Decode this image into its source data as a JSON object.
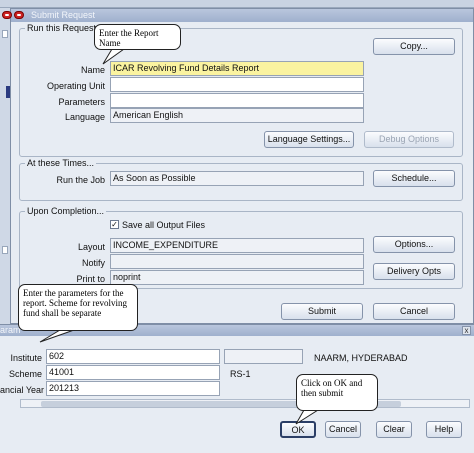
{
  "submit_request": {
    "title": "Submit Request",
    "run_group_label": "Run this Request...",
    "copy_label": "Copy...",
    "name_label": "Name",
    "name_value": "ICAR Revolving Fund Details Report",
    "operating_unit_label": "Operating Unit",
    "operating_unit_value": "",
    "parameters_label": "Parameters",
    "parameters_value": "",
    "language_label": "Language",
    "language_value": "American English",
    "language_settings_label": "Language Settings...",
    "debug_options_label": "Debug Options",
    "times_group_label": "At these Times...",
    "run_job_label": "Run the Job",
    "run_job_value": "As Soon as Possible",
    "schedule_label": "Schedule...",
    "completion_group_label": "Upon Completion...",
    "save_outputs_label": "Save all Output Files",
    "save_outputs_checked": "✓",
    "layout_label": "Layout",
    "layout_value": "INCOME_EXPENDITURE",
    "options_label": "Options...",
    "notify_label": "Notify",
    "notify_value": "",
    "print_to_label": "Print to",
    "print_to_value": "noprint",
    "delivery_opts_label": "Delivery Opts",
    "submit_label": "Submit",
    "cancel_label": "Cancel"
  },
  "parameters_window": {
    "title": "aram",
    "close_glyph": "x",
    "institute_label": "Institute",
    "institute_value": "602",
    "institute_desc": "",
    "institute_name": "NAARM, HYDERABAD",
    "scheme_label": "Scheme",
    "scheme_value": "41001",
    "scheme_desc": "RS-1",
    "financial_year_label": "ancial Year",
    "financial_year_value": "201213",
    "ok_label": "OK",
    "cancel_label": "Cancel",
    "clear_label": "Clear",
    "help_label": "Help"
  },
  "callouts": {
    "report_name": "Enter the Report Name",
    "parameters": "Enter the parameters for the report. Scheme for revolving fund shall be separate",
    "ok_submit": "Click on OK and then submit"
  },
  "colors": {
    "title_bar": "#a8b8d4",
    "name_highlight": "#faf3a0",
    "close_icon": "#cc2222"
  }
}
